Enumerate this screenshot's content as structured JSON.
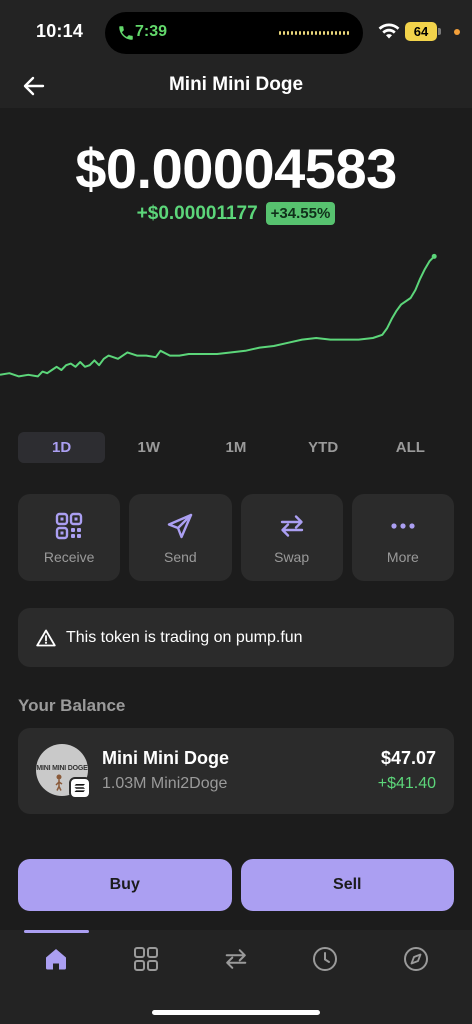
{
  "status_bar": {
    "time": "10:14",
    "call_time": "7:39",
    "battery": "64"
  },
  "header": {
    "title": "Mini Mini Doge",
    "back_icon": "arrow-left-icon"
  },
  "price": {
    "value": "$0.00004583",
    "change": "+$0.00001177",
    "change_percent": "+34.55%"
  },
  "chart_data": {
    "type": "line",
    "points": [
      [
        0.0,
        0.78
      ],
      [
        0.02,
        0.77
      ],
      [
        0.04,
        0.79
      ],
      [
        0.06,
        0.78
      ],
      [
        0.08,
        0.79
      ],
      [
        0.09,
        0.76
      ],
      [
        0.1,
        0.77
      ],
      [
        0.11,
        0.75
      ],
      [
        0.12,
        0.73
      ],
      [
        0.13,
        0.75
      ],
      [
        0.14,
        0.72
      ],
      [
        0.15,
        0.71
      ],
      [
        0.16,
        0.73
      ],
      [
        0.17,
        0.7
      ],
      [
        0.18,
        0.73
      ],
      [
        0.19,
        0.72
      ],
      [
        0.2,
        0.69
      ],
      [
        0.21,
        0.72
      ],
      [
        0.22,
        0.68
      ],
      [
        0.23,
        0.66
      ],
      [
        0.25,
        0.68
      ],
      [
        0.27,
        0.64
      ],
      [
        0.29,
        0.66
      ],
      [
        0.31,
        0.66
      ],
      [
        0.33,
        0.67
      ],
      [
        0.34,
        0.63
      ],
      [
        0.36,
        0.66
      ],
      [
        0.38,
        0.66
      ],
      [
        0.4,
        0.65
      ],
      [
        0.43,
        0.65
      ],
      [
        0.46,
        0.65
      ],
      [
        0.49,
        0.64
      ],
      [
        0.52,
        0.63
      ],
      [
        0.55,
        0.61
      ],
      [
        0.58,
        0.6
      ],
      [
        0.61,
        0.58
      ],
      [
        0.64,
        0.56
      ],
      [
        0.67,
        0.55
      ],
      [
        0.7,
        0.56
      ],
      [
        0.73,
        0.56
      ],
      [
        0.76,
        0.56
      ],
      [
        0.79,
        0.55
      ],
      [
        0.81,
        0.53
      ],
      [
        0.82,
        0.49
      ],
      [
        0.83,
        0.43
      ],
      [
        0.84,
        0.38
      ],
      [
        0.85,
        0.34
      ],
      [
        0.87,
        0.3
      ],
      [
        0.88,
        0.25
      ],
      [
        0.89,
        0.18
      ],
      [
        0.9,
        0.12
      ],
      [
        0.91,
        0.07
      ],
      [
        0.92,
        0.04
      ]
    ],
    "color": "#5cd67a"
  },
  "range_tabs": [
    {
      "label": "1D",
      "active": true
    },
    {
      "label": "1W",
      "active": false
    },
    {
      "label": "1M",
      "active": false
    },
    {
      "label": "YTD",
      "active": false
    },
    {
      "label": "ALL",
      "active": false
    }
  ],
  "actions": [
    {
      "label": "Receive",
      "icon": "qr-code-icon"
    },
    {
      "label": "Send",
      "icon": "send-icon"
    },
    {
      "label": "Swap",
      "icon": "swap-icon"
    },
    {
      "label": "More",
      "icon": "more-icon"
    }
  ],
  "warning": {
    "text": "This token is trading on pump.fun",
    "icon": "warning-icon"
  },
  "balance": {
    "heading": "Your Balance",
    "logo_text": "MINI MINI DOGE",
    "token_name": "Mini Mini Doge",
    "amount": "1.03M Mini2Doge",
    "value": "$47.07",
    "change": "+$41.40"
  },
  "trade": {
    "buy": "Buy",
    "sell": "Sell"
  },
  "tab_bar": [
    {
      "icon": "home-icon",
      "active": true
    },
    {
      "icon": "grid-icon",
      "active": false
    },
    {
      "icon": "swap-icon",
      "active": false
    },
    {
      "icon": "clock-icon",
      "active": false
    },
    {
      "icon": "compass-icon",
      "active": false
    }
  ],
  "colors": {
    "accent": "#ab9ff2",
    "positive": "#5cd67a",
    "background": "#1c1c1c",
    "card": "#2b2b2b"
  }
}
